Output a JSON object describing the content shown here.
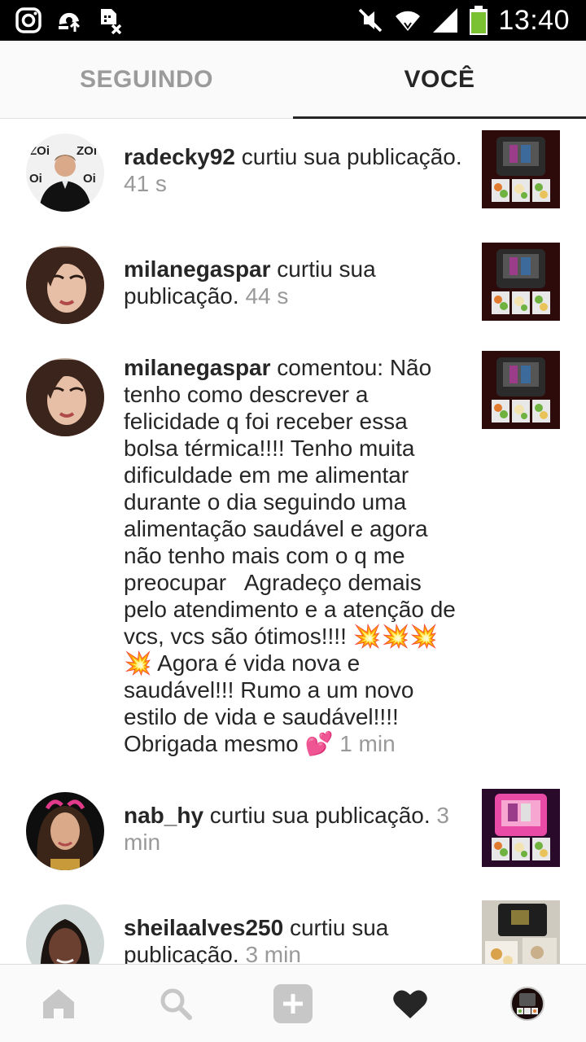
{
  "status_bar": {
    "time": "13:40",
    "left_icons": [
      "instagram-icon",
      "upload-icon",
      "sim-off-icon"
    ],
    "right_icons": [
      "mute-icon",
      "wifi-icon",
      "signal-icon",
      "battery-icon"
    ]
  },
  "tabs": [
    {
      "label": "SEGUINDO",
      "active": false
    },
    {
      "label": "VOCÊ",
      "active": true
    }
  ],
  "activity": [
    {
      "username": "radecky92",
      "action": " curtiu sua publicação. ",
      "time": "41 s"
    },
    {
      "username": "milanegaspar",
      "action": " curtiu sua publicação. ",
      "time": "44 s"
    },
    {
      "username": "milanegaspar",
      "action": " comentou: Não tenho como descrever a felicidade q foi receber essa bolsa térmica!!!! Tenho muita dificuldade em me alimentar durante o dia seguindo uma alimentação saudável e agora não tenho mais com o q me preocupar   Agradeço demais pelo atendimento e a atenção de vcs, vcs são ótimos!!!! 💥💥💥💥 Agora é vida nova e saudável!!! Rumo a um novo estilo de vida e saudável!!!! Obrigada mesmo 💕 ",
      "time": "1 min"
    },
    {
      "username": "nab_hy",
      "action": " curtiu sua publicação. ",
      "time": "3 min"
    },
    {
      "username": "sheilaalves250",
      "action": " curtiu sua publicação. ",
      "time": "3 min"
    }
  ],
  "bottom_nav": [
    "home-icon",
    "search-icon",
    "add-post-icon",
    "activity-heart-icon",
    "profile-icon"
  ],
  "colors": {
    "text": "#262626",
    "muted": "#999999",
    "tab_inactive": "#9b9b9b",
    "nav_icon": "#c7c7c7"
  }
}
